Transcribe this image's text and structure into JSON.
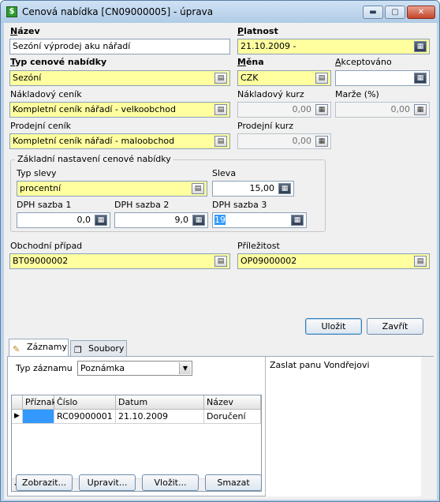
{
  "window": {
    "title": "Cenová nabídka [CN09000005] - úprava",
    "controls": {
      "minimize": "▬",
      "maximize": "▢",
      "close": "✕"
    }
  },
  "form": {
    "nazev": {
      "label_u": "N",
      "label_rest": "ázev",
      "value": "Sezóní výprodej aku nářadí"
    },
    "platnost": {
      "label_u": "P",
      "label_rest": "latnost",
      "value": "21.10.2009 -"
    },
    "typ": {
      "label_u": "T",
      "label_rest": "yp cenové nabídky",
      "value": "Sezóní"
    },
    "mena": {
      "label_u": "M",
      "label_rest": "ěna",
      "value": "CZK"
    },
    "akceptovano": {
      "label_u": "A",
      "label_rest": "kceptováno",
      "value": ""
    },
    "nakladovy_cenik": {
      "label": "Nákladový ceník",
      "value": "Kompletní ceník nářadí - velkoobchod"
    },
    "nakladovy_kurz": {
      "label": "Nákladový kurz",
      "value": "0,00"
    },
    "marze": {
      "label": "Marže (%)",
      "value": "0,00"
    },
    "prodejni_cenik": {
      "label": "Prodejní ceník",
      "value": "Kompletní ceník nářadí - maloobchod"
    },
    "prodejni_kurz": {
      "label": "Prodejní kurz",
      "value": "0,00"
    },
    "group_title": "Základní nastavení cenové nabídky",
    "typ_slevy": {
      "label": "Typ slevy",
      "value": "procentní"
    },
    "sleva": {
      "label": "Sleva",
      "value": "15,00"
    },
    "dph1": {
      "label": "DPH sazba 1",
      "value": "0,0"
    },
    "dph2": {
      "label": "DPH sazba 2",
      "value": "9,0"
    },
    "dph3": {
      "label": "DPH sazba 3",
      "value": "19"
    },
    "obchodni_pripad": {
      "label": "Obchodní případ",
      "value": "BT09000002"
    },
    "prilezitost": {
      "label": "Příležitost",
      "value": "OP09000002"
    }
  },
  "buttons": {
    "ulozit": "Uložit",
    "zavrit": "Zavřít",
    "zobrazit": "Zobrazit...",
    "upravit": "Upravit...",
    "vlozit": "Vložit...",
    "smazat": "Smazat"
  },
  "tabs": [
    {
      "label": "Záznamy"
    },
    {
      "label": "Soubory"
    }
  ],
  "records": {
    "typ_label": "Typ záznamu",
    "typ_value": "Poznámka",
    "columns": [
      "Příznak",
      "Číslo",
      "Datum",
      "Název"
    ],
    "rows": [
      {
        "priznak": "",
        "cislo": "RC09000001",
        "datum": "21.10.2009",
        "nazev": "Doručení"
      }
    ],
    "note": "Zaslat panu Vondřejovi"
  },
  "colors": {
    "required_field": "#ffffa0",
    "window_frame": "#bcd4ea"
  }
}
